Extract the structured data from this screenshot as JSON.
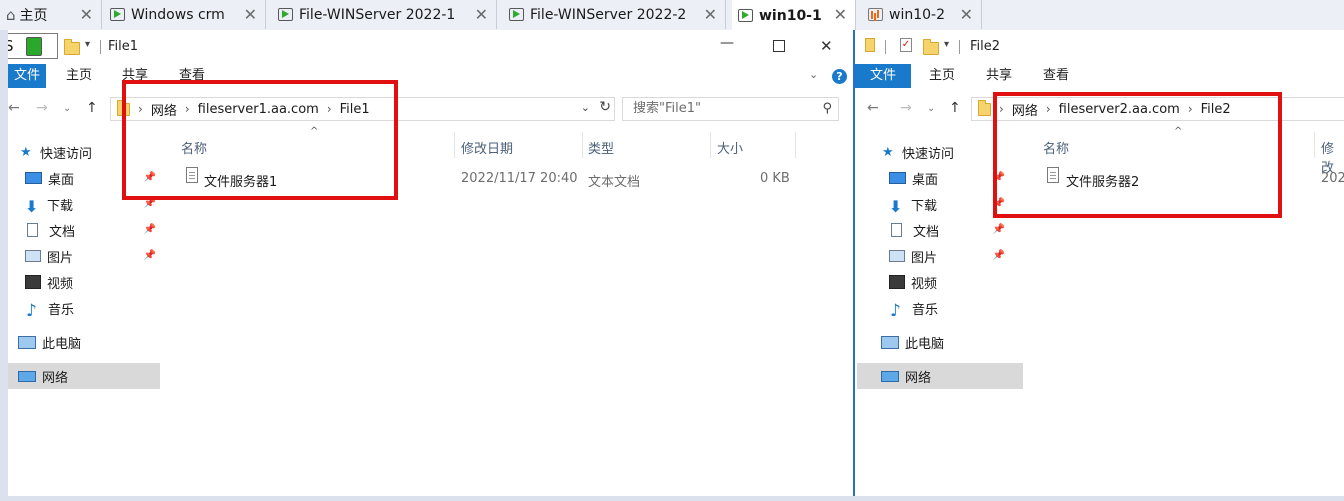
{
  "tabs": [
    {
      "label": "主页",
      "icon": "home-icon"
    },
    {
      "label": "Windows crm",
      "icon": "vm-running-icon"
    },
    {
      "label": "File-WINServer 2022-1",
      "icon": "vm-running-icon"
    },
    {
      "label": "File-WINServer 2022-2",
      "icon": "vm-running-icon"
    },
    {
      "label": "win10-1",
      "icon": "vm-running-icon",
      "active": true
    },
    {
      "label": "win10-2",
      "icon": "vm-chart-icon"
    }
  ],
  "close_glyph": "✕",
  "left_stub": "S",
  "explorer1": {
    "title": "File1",
    "ribbon": [
      "文件",
      "主页",
      "共享",
      "查看"
    ],
    "breadcrumb": [
      "网络",
      "fileserver1.aa.com",
      "File1"
    ],
    "search_placeholder": "搜索\"File1\"",
    "columns": [
      "名称",
      "修改日期",
      "类型",
      "大小"
    ],
    "files": [
      {
        "name": "文件服务器1",
        "modified": "2022/11/17 20:40",
        "type": "文本文档",
        "size": "0 KB"
      }
    ],
    "nav": {
      "quick_access": "快速访问",
      "items": [
        "桌面",
        "下载",
        "文档",
        "图片",
        "视频",
        "音乐"
      ],
      "this_pc": "此电脑",
      "network": "网络"
    }
  },
  "explorer2": {
    "title": "File2",
    "ribbon": [
      "文件",
      "主页",
      "共享",
      "查看"
    ],
    "breadcrumb": [
      "网络",
      "fileserver2.aa.com",
      "File2"
    ],
    "columns": [
      "名称",
      "修改"
    ],
    "files": [
      {
        "name": "文件服务器2",
        "modified": "202"
      }
    ],
    "nav": {
      "quick_access": "快速访问",
      "items": [
        "桌面",
        "下载",
        "文档",
        "图片",
        "视频",
        "音乐"
      ],
      "this_pc": "此电脑",
      "network": "网络"
    }
  },
  "colors": {
    "ribbon_file": "#1979ca",
    "highlight": "#e01010",
    "active_border": "#2c6fc9"
  }
}
